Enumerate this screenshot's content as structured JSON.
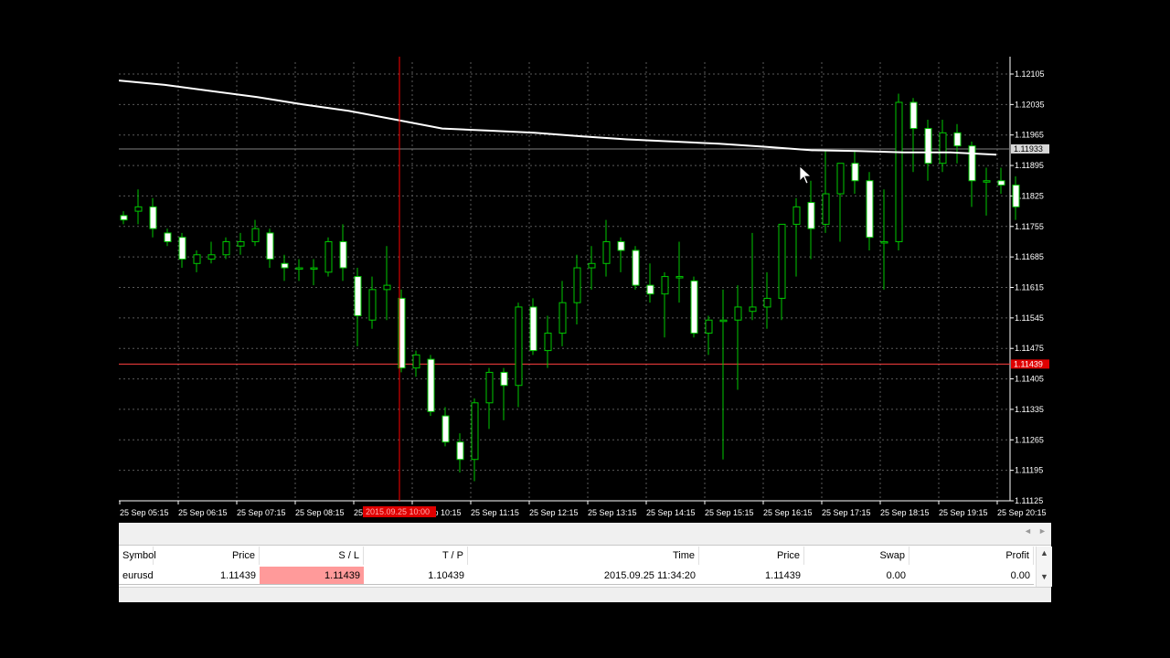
{
  "chart": {
    "symbol": "eurusd",
    "colors": {
      "background": "#000000",
      "grid": "#5a5a5a",
      "candle_bull_fill": "#000000",
      "candle_bear_fill": "#ffffff",
      "candle_outline": "#00c800",
      "wick": "#00c800",
      "moving_average": "#ffffff",
      "crosshair": "#ff0000",
      "bid_line": "#808080",
      "sl_line": "#ff4040",
      "axis_text": "#ffffff"
    },
    "price_axis": {
      "ticks": [
        "1.12105",
        "1.12035",
        "1.11965",
        "1.11895",
        "1.11825",
        "1.11755",
        "1.11685",
        "1.11615",
        "1.11545",
        "1.11475",
        "1.11405",
        "1.11335",
        "1.11265",
        "1.11195",
        "1.11125"
      ],
      "bid_label": "1.11933",
      "sl_label": "1.11439"
    },
    "time_axis": {
      "ticks": [
        "25 Sep 05:15",
        "25 Sep 06:15",
        "25 Sep 07:15",
        "25 Sep 08:15",
        "25 Sep 09:15",
        "25 Sep 10:15",
        "25 Sep 11:15",
        "25 Sep 12:15",
        "25 Sep 13:15",
        "25 Sep 14:15",
        "25 Sep 15:15",
        "25 Sep 16:15",
        "25 Sep 17:15",
        "25 Sep 18:15",
        "25 Sep 19:15",
        "25 Sep 20:15"
      ],
      "crosshair_label": "2015.09.25 10:00"
    },
    "bid_price": 1.11933,
    "sl_price": 1.11439,
    "price_min": 1.11125,
    "price_max": 1.12105,
    "candles": [
      {
        "o": 1.1178,
        "h": 1.1179,
        "l": 1.1176,
        "c": 1.1177
      },
      {
        "o": 1.1179,
        "h": 1.1184,
        "l": 1.1176,
        "c": 1.118
      },
      {
        "o": 1.118,
        "h": 1.1182,
        "l": 1.1173,
        "c": 1.1175
      },
      {
        "o": 1.1174,
        "h": 1.1175,
        "l": 1.1171,
        "c": 1.1172
      },
      {
        "o": 1.1173,
        "h": 1.1174,
        "l": 1.1166,
        "c": 1.1168
      },
      {
        "o": 1.1167,
        "h": 1.117,
        "l": 1.1165,
        "c": 1.1169
      },
      {
        "o": 1.1168,
        "h": 1.1172,
        "l": 1.1167,
        "c": 1.1169
      },
      {
        "o": 1.1169,
        "h": 1.1173,
        "l": 1.1168,
        "c": 1.1172
      },
      {
        "o": 1.1171,
        "h": 1.1174,
        "l": 1.1169,
        "c": 1.1172
      },
      {
        "o": 1.1172,
        "h": 1.1177,
        "l": 1.1171,
        "c": 1.1175
      },
      {
        "o": 1.1174,
        "h": 1.1175,
        "l": 1.1166,
        "c": 1.1168
      },
      {
        "o": 1.1167,
        "h": 1.1169,
        "l": 1.1163,
        "c": 1.1166
      },
      {
        "o": 1.1166,
        "h": 1.1168,
        "l": 1.1163,
        "c": 1.1166
      },
      {
        "o": 1.1166,
        "h": 1.1168,
        "l": 1.1162,
        "c": 1.1166
      },
      {
        "o": 1.1165,
        "h": 1.1173,
        "l": 1.1164,
        "c": 1.1172
      },
      {
        "o": 1.1172,
        "h": 1.1176,
        "l": 1.1163,
        "c": 1.1166
      },
      {
        "o": 1.1164,
        "h": 1.1166,
        "l": 1.1148,
        "c": 1.1155
      },
      {
        "o": 1.1154,
        "h": 1.1164,
        "l": 1.1152,
        "c": 1.1161
      },
      {
        "o": 1.1161,
        "h": 1.1171,
        "l": 1.1154,
        "c": 1.1162
      },
      {
        "o": 1.1159,
        "h": 1.1161,
        "l": 1.1142,
        "c": 1.1143
      },
      {
        "o": 1.1143,
        "h": 1.1147,
        "l": 1.1141,
        "c": 1.1146
      },
      {
        "o": 1.1145,
        "h": 1.1146,
        "l": 1.1132,
        "c": 1.1133
      },
      {
        "o": 1.1132,
        "h": 1.1134,
        "l": 1.1125,
        "c": 1.1126
      },
      {
        "o": 1.1126,
        "h": 1.1128,
        "l": 1.1119,
        "c": 1.1122
      },
      {
        "o": 1.1122,
        "h": 1.1136,
        "l": 1.1117,
        "c": 1.1135
      },
      {
        "o": 1.1135,
        "h": 1.1143,
        "l": 1.1129,
        "c": 1.1142
      },
      {
        "o": 1.1142,
        "h": 1.1143,
        "l": 1.1131,
        "c": 1.1139
      },
      {
        "o": 1.1139,
        "h": 1.1158,
        "l": 1.1134,
        "c": 1.1157
      },
      {
        "o": 1.1157,
        "h": 1.1159,
        "l": 1.1146,
        "c": 1.1147
      },
      {
        "o": 1.1147,
        "h": 1.1155,
        "l": 1.1143,
        "c": 1.1151
      },
      {
        "o": 1.1151,
        "h": 1.1163,
        "l": 1.1148,
        "c": 1.1158
      },
      {
        "o": 1.1158,
        "h": 1.1169,
        "l": 1.1153,
        "c": 1.1166
      },
      {
        "o": 1.1166,
        "h": 1.1171,
        "l": 1.1161,
        "c": 1.1167
      },
      {
        "o": 1.1167,
        "h": 1.1177,
        "l": 1.1164,
        "c": 1.1172
      },
      {
        "o": 1.1172,
        "h": 1.1173,
        "l": 1.1165,
        "c": 1.117
      },
      {
        "o": 1.117,
        "h": 1.1171,
        "l": 1.1161,
        "c": 1.1162
      },
      {
        "o": 1.1162,
        "h": 1.1167,
        "l": 1.1158,
        "c": 1.116
      },
      {
        "o": 1.116,
        "h": 1.1165,
        "l": 1.115,
        "c": 1.1164
      },
      {
        "o": 1.1164,
        "h": 1.1172,
        "l": 1.1158,
        "c": 1.1164
      },
      {
        "o": 1.1163,
        "h": 1.1164,
        "l": 1.115,
        "c": 1.1151
      },
      {
        "o": 1.1151,
        "h": 1.1155,
        "l": 1.1146,
        "c": 1.1154
      },
      {
        "o": 1.1154,
        "h": 1.1161,
        "l": 1.1122,
        "c": 1.1154
      },
      {
        "o": 1.1154,
        "h": 1.1162,
        "l": 1.1138,
        "c": 1.1157
      },
      {
        "o": 1.1156,
        "h": 1.1174,
        "l": 1.1154,
        "c": 1.1157
      },
      {
        "o": 1.1157,
        "h": 1.1165,
        "l": 1.1152,
        "c": 1.1159
      },
      {
        "o": 1.1159,
        "h": 1.1176,
        "l": 1.1154,
        "c": 1.1176
      },
      {
        "o": 1.1176,
        "h": 1.1182,
        "l": 1.1164,
        "c": 1.118
      },
      {
        "o": 1.1181,
        "h": 1.1186,
        "l": 1.1168,
        "c": 1.1175
      },
      {
        "o": 1.1176,
        "h": 1.1193,
        "l": 1.1174,
        "c": 1.1183
      },
      {
        "o": 1.1183,
        "h": 1.119,
        "l": 1.1172,
        "c": 1.119
      },
      {
        "o": 1.119,
        "h": 1.1193,
        "l": 1.1183,
        "c": 1.1186
      },
      {
        "o": 1.1186,
        "h": 1.1188,
        "l": 1.117,
        "c": 1.1173
      },
      {
        "o": 1.1172,
        "h": 1.1184,
        "l": 1.1161,
        "c": 1.1172
      },
      {
        "o": 1.1172,
        "h": 1.1206,
        "l": 1.117,
        "c": 1.1204
      },
      {
        "o": 1.1204,
        "h": 1.1205,
        "l": 1.1188,
        "c": 1.1198
      },
      {
        "o": 1.1198,
        "h": 1.12,
        "l": 1.1186,
        "c": 1.119
      },
      {
        "o": 1.119,
        "h": 1.12,
        "l": 1.1188,
        "c": 1.1197
      },
      {
        "o": 1.1197,
        "h": 1.1199,
        "l": 1.119,
        "c": 1.1194
      },
      {
        "o": 1.1194,
        "h": 1.1195,
        "l": 1.118,
        "c": 1.1186
      },
      {
        "o": 1.1186,
        "h": 1.1189,
        "l": 1.1178,
        "c": 1.1186
      },
      {
        "o": 1.1186,
        "h": 1.1189,
        "l": 1.1183,
        "c": 1.1185
      },
      {
        "o": 1.1185,
        "h": 1.1187,
        "l": 1.1177,
        "c": 1.118
      }
    ],
    "moving_average": [
      1.1209,
      1.1208,
      1.12066,
      1.12052,
      1.12035,
      1.1202,
      1.12,
      1.1198,
      1.11975,
      1.1197,
      1.11962,
      1.11955,
      1.1195,
      1.11945,
      1.11938,
      1.1193,
      1.11928,
      1.11925,
      1.11925,
      1.1192
    ]
  },
  "terminal": {
    "columns": {
      "symbol": "Symbol",
      "price": "Price",
      "sl": "S / L",
      "tp": "T / P",
      "time": "Time",
      "price2": "Price",
      "swap": "Swap",
      "profit": "Profit"
    },
    "row": {
      "symbol": "eurusd",
      "price": "1.11439",
      "sl": "1.11439",
      "tp": "1.10439",
      "time": "2015.09.25 11:34:20",
      "price2": "1.11439",
      "swap": "0.00",
      "profit": "0.00"
    }
  }
}
